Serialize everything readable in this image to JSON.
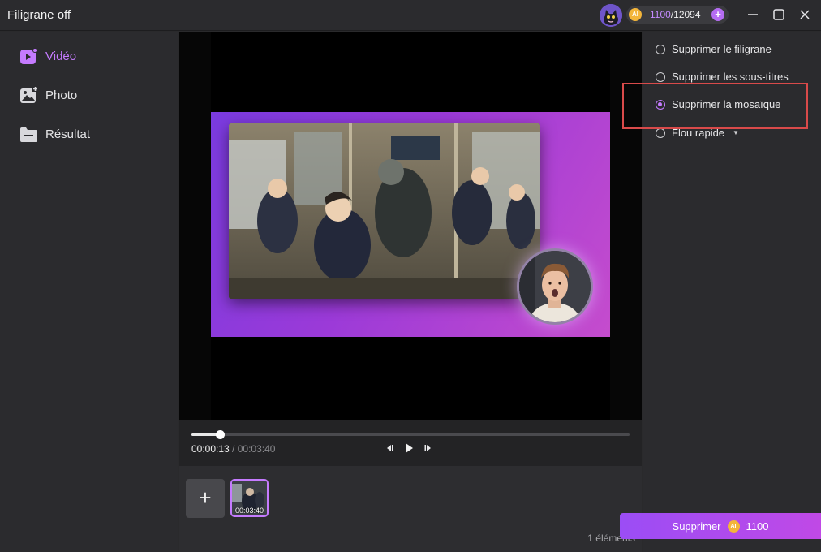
{
  "window": {
    "title": "Filigrane off",
    "credits_used": "1100",
    "credits_total": "/12094",
    "ai_badge": "AI",
    "plus_label": "+",
    "minimize_label": "minimize",
    "maximize_label": "maximize",
    "close_label": "close"
  },
  "sidebar": {
    "items": [
      {
        "label": "Vidéo",
        "icon": "video-icon",
        "active": true
      },
      {
        "label": "Photo",
        "icon": "photo-icon",
        "active": false
      },
      {
        "label": "Résultat",
        "icon": "folder-icon",
        "active": false
      }
    ]
  },
  "player": {
    "current_time": "00:00:13",
    "total_time": " / 00:03:40",
    "progress": 0.065
  },
  "media": {
    "add_label": "+",
    "clips": [
      {
        "duration": "00:03:40"
      }
    ],
    "count_label": "1 éléments"
  },
  "options": {
    "items": [
      {
        "label": "Supprimer le filigrane",
        "selected": false
      },
      {
        "label": "Supprimer les sous-titres",
        "selected": false
      },
      {
        "label": "Supprimer la mosaïque",
        "selected": true
      },
      {
        "label": "Flou rapide",
        "selected": false,
        "dropdown": true
      }
    ]
  },
  "action": {
    "label": "Supprimer",
    "cost": "1100",
    "ai_badge": "AI"
  },
  "colors": {
    "accent": "#c57bff",
    "highlight_border": "#d94a4a",
    "button_gradient_start": "#9b4df5",
    "button_gradient_end": "#c049e6"
  }
}
